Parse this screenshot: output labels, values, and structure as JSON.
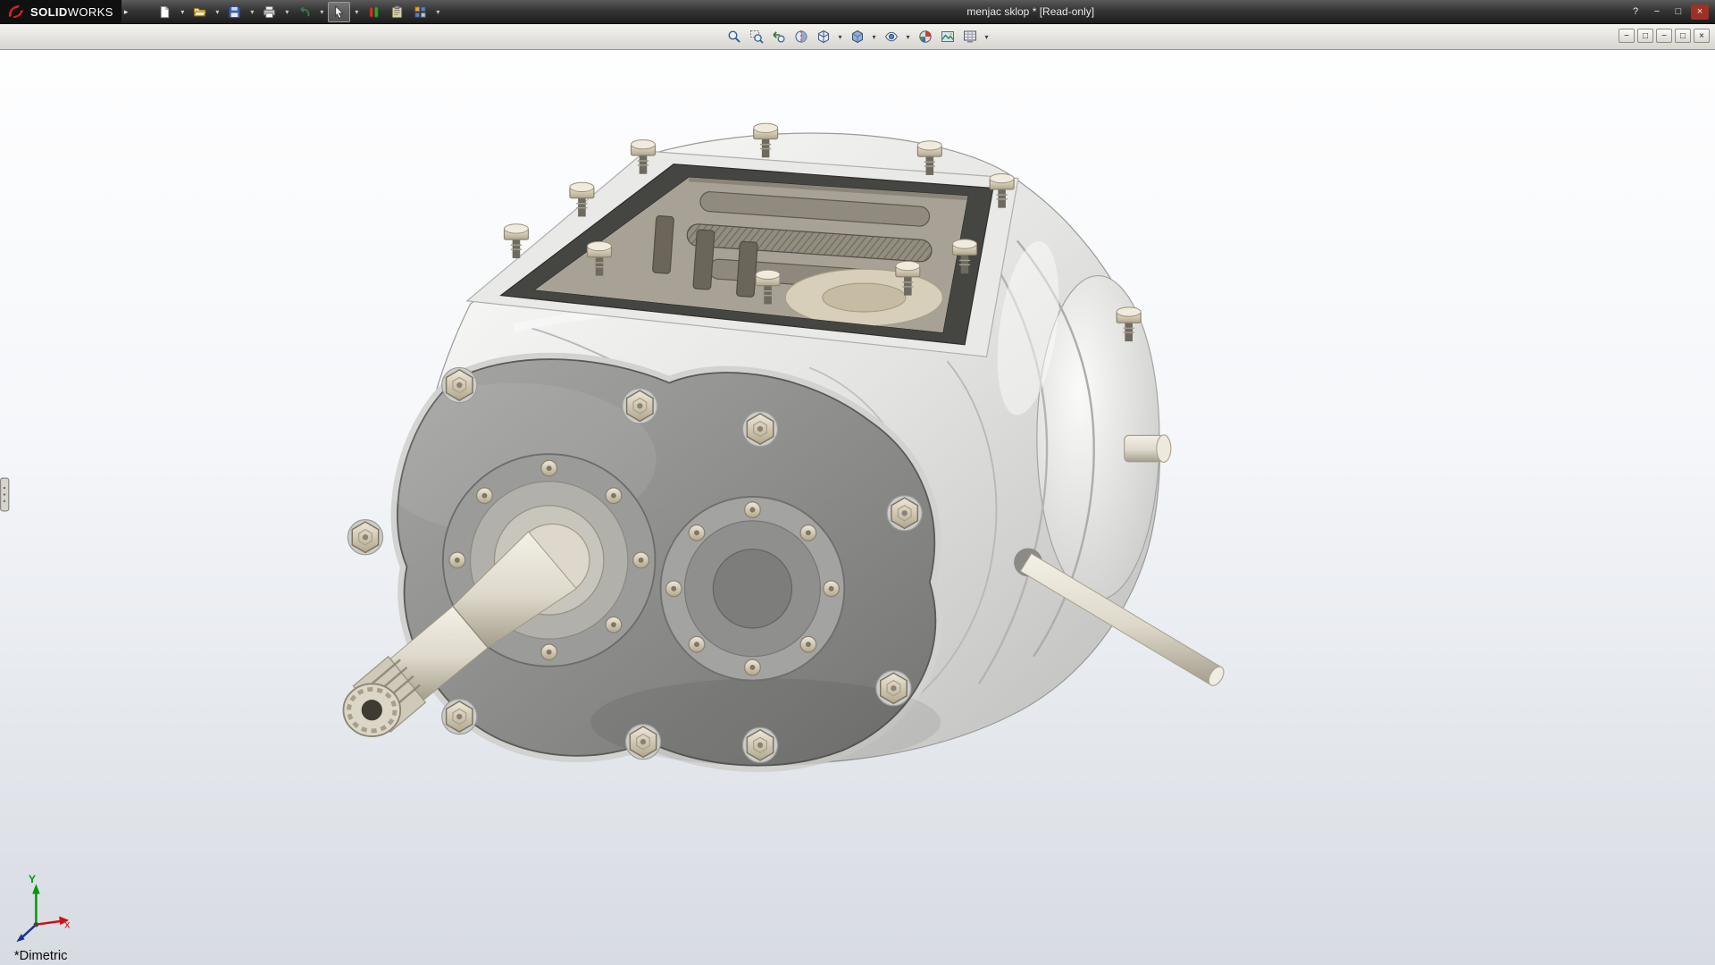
{
  "titlebar": {
    "brand_bold": "SOLID",
    "brand_light": "WORKS",
    "menu_arrow": "▸",
    "title": "menjac sklop * [Read-only]",
    "tools": [
      {
        "name": "new-document",
        "icon": "new-doc",
        "dropdown": true
      },
      {
        "name": "open",
        "icon": "open",
        "dropdown": true
      },
      {
        "name": "save",
        "icon": "save",
        "dropdown": true
      },
      {
        "name": "print",
        "icon": "print",
        "dropdown": true
      },
      {
        "name": "undo",
        "icon": "undo",
        "dropdown": true
      },
      {
        "name": "select",
        "icon": "select",
        "dropdown": true,
        "active": true
      },
      {
        "name": "selection-filter",
        "icon": "filter",
        "dropdown": false
      },
      {
        "name": "copy-options",
        "icon": "clipboard",
        "dropdown": false
      },
      {
        "name": "options",
        "icon": "options",
        "dropdown": true
      }
    ],
    "window_controls": [
      {
        "name": "help",
        "glyph": "?"
      },
      {
        "name": "minimize",
        "glyph": "−"
      },
      {
        "name": "maximize",
        "glyph": "□"
      },
      {
        "name": "close",
        "glyph": "×"
      }
    ]
  },
  "view_toolbar": {
    "tools": [
      {
        "name": "zoom-to-fit",
        "icon": "zoom-fit",
        "dropdown": false
      },
      {
        "name": "zoom-to-area",
        "icon": "zoom-area",
        "dropdown": false
      },
      {
        "name": "previous-view",
        "icon": "prev-view",
        "dropdown": false
      },
      {
        "name": "section-view",
        "icon": "section",
        "dropdown": false
      },
      {
        "name": "view-orientation",
        "icon": "orientation",
        "dropdown": true
      },
      {
        "name": "display-style",
        "icon": "display-style",
        "dropdown": true
      },
      {
        "name": "hide-show-items",
        "icon": "hide-show",
        "dropdown": true
      },
      {
        "name": "edit-appearance",
        "icon": "appearance",
        "dropdown": false
      },
      {
        "name": "apply-scene",
        "icon": "scene",
        "dropdown": false
      },
      {
        "name": "view-settings",
        "icon": "view-settings",
        "dropdown": true
      }
    ],
    "window_controls": [
      {
        "name": "frame-minimize",
        "glyph": "−"
      },
      {
        "name": "frame-restore",
        "glyph": "□"
      },
      {
        "name": "doc-minimize",
        "glyph": "−"
      },
      {
        "name": "doc-restore",
        "glyph": "□"
      },
      {
        "name": "doc-close",
        "glyph": "×"
      }
    ]
  },
  "viewport": {
    "orientation_label": "*Dimetric",
    "axis_x_label": "x",
    "axis_y_label": "Y"
  },
  "ui": {
    "dropdown_glyph": "▾"
  },
  "colors": {
    "titlebar_bg": "#353535",
    "toolbar_bg": "#d8d5cf",
    "viewport_top": "#ffffff",
    "viewport_bottom": "#d7dbe2",
    "logo_red": "#d2232a"
  }
}
